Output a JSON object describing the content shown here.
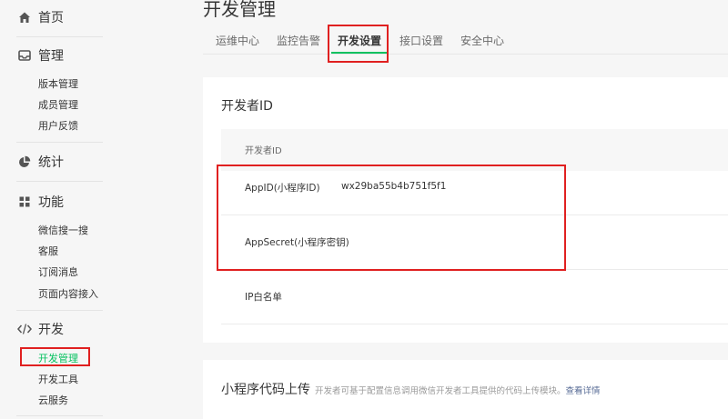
{
  "sidebar": {
    "home": {
      "label": "首页",
      "icon": "home-icon"
    },
    "manage": {
      "label": "管理",
      "icon": "inbox-icon",
      "items": [
        "版本管理",
        "成员管理",
        "用户反馈"
      ]
    },
    "stats": {
      "label": "统计",
      "icon": "pie-chart-icon"
    },
    "features": {
      "label": "功能",
      "icon": "grid-icon",
      "items": [
        "微信搜一搜",
        "客服",
        "订阅消息",
        "页面内容接入"
      ]
    },
    "dev": {
      "label": "开发",
      "icon": "code-icon",
      "items": [
        "开发管理",
        "开发工具",
        "云服务"
      ],
      "active_item": "开发管理"
    }
  },
  "page": {
    "title": "开发管理",
    "tabs": [
      "运维中心",
      "监控告警",
      "开发设置",
      "接口设置",
      "安全中心"
    ],
    "active_tab": "开发设置"
  },
  "developer_id": {
    "title": "开发者ID",
    "table_header": "开发者ID",
    "rows": [
      {
        "label": "AppID(小程序ID)",
        "value": "wx29ba55b4b751f5f1"
      },
      {
        "label": "AppSecret(小程序密钥)",
        "value": ""
      },
      {
        "label": "IP白名单",
        "value": ""
      }
    ]
  },
  "upload": {
    "title": "小程序代码上传",
    "description": "开发者可基于配置信息调用微信开发者工具提供的代码上传模块。",
    "link": "查看详情"
  },
  "colors": {
    "accent": "#07c160",
    "highlight": "#e02020",
    "link": "#576b95"
  }
}
